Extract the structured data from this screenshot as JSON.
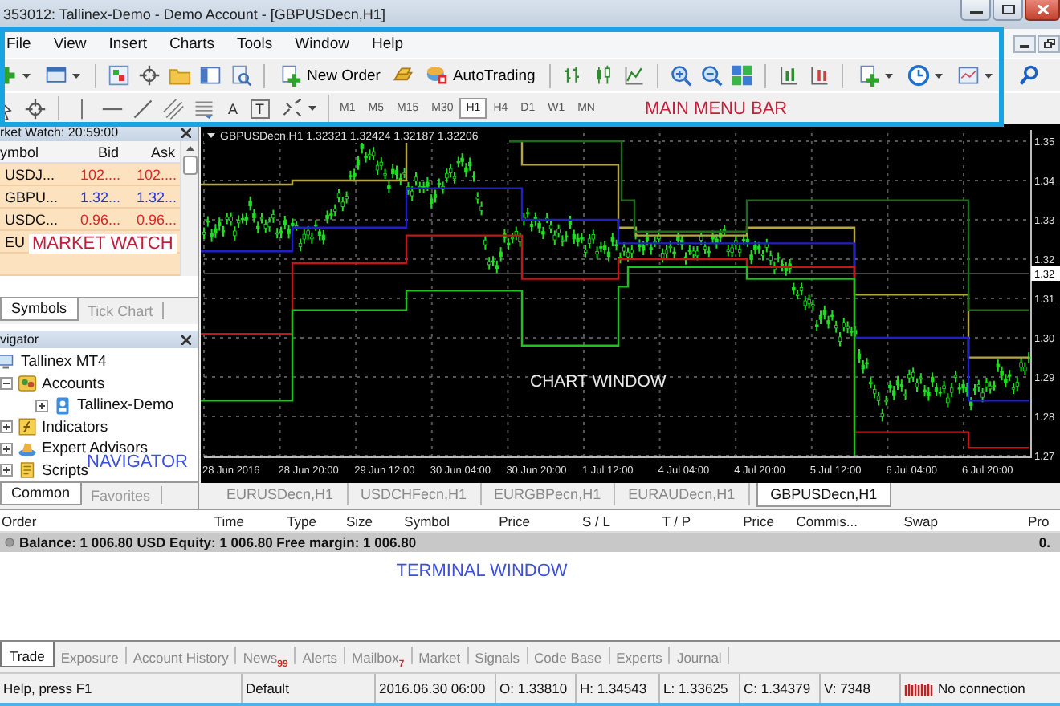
{
  "window": {
    "title": "353012: Tallinex-Demo - Demo Account - [GBPUSDecn,H1]"
  },
  "menu": [
    "File",
    "View",
    "Insert",
    "Charts",
    "Tools",
    "Window",
    "Help"
  ],
  "toolbar": {
    "new_order": "New Order",
    "autotrading": "AutoTrading",
    "text_tools": [
      "A",
      "T"
    ],
    "timeframes": [
      {
        "label": "M1",
        "selected": false
      },
      {
        "label": "M5",
        "selected": false
      },
      {
        "label": "M15",
        "selected": false
      },
      {
        "label": "M30",
        "selected": false
      },
      {
        "label": "H1",
        "selected": true
      },
      {
        "label": "H4",
        "selected": false
      },
      {
        "label": "D1",
        "selected": false
      },
      {
        "label": "W1",
        "selected": false
      },
      {
        "label": "MN",
        "selected": false
      }
    ],
    "callout": "MAIN MENU BAR"
  },
  "market_watch": {
    "title": "rket Watch: 20:59:00",
    "columns": [
      "ymbol",
      "Bid",
      "Ask"
    ],
    "rows": [
      {
        "symbol": "USDJ...",
        "bid": "102....",
        "ask": "102....",
        "color": "#e0242a"
      },
      {
        "symbol": "GBPU...",
        "bid": "1.32...",
        "ask": "1.32...",
        "color": "#2635d6"
      },
      {
        "symbol": "USDC...",
        "bid": "0.96...",
        "ask": "0.96...",
        "color": "#e0242a"
      },
      {
        "symbol": "EU"
      }
    ],
    "callout": "MARKET WATCH",
    "tabs": [
      {
        "label": "Symbols",
        "selected": true
      },
      {
        "label": "Tick Chart",
        "selected": false
      }
    ]
  },
  "navigator": {
    "title": "vigator",
    "tree": [
      {
        "label": "Tallinex MT4",
        "kind": "terminal",
        "children": [
          {
            "label": "Accounts",
            "kind": "accounts",
            "expanded": true,
            "children": [
              {
                "label": "Tallinex-Demo",
                "kind": "account",
                "expanded": false
              }
            ]
          },
          {
            "label": "Indicators",
            "kind": "indicators",
            "expanded": false
          },
          {
            "label": "Expert Advisors",
            "kind": "experts",
            "expanded": false
          },
          {
            "label": "Scripts",
            "kind": "scripts",
            "expanded": false
          }
        ]
      }
    ],
    "callout": "NAVIGATOR",
    "tabs": [
      {
        "label": "Common",
        "selected": true
      },
      {
        "label": "Favorites",
        "selected": false
      }
    ]
  },
  "chart": {
    "header": "GBPUSDecn,H1  1.32321 1.32424 1.32187 1.32206",
    "y_labels": [
      "1.35",
      "1.34",
      "1.33",
      "1.32",
      "1.31",
      "1.30",
      "1.29",
      "1.28",
      "1.27"
    ],
    "x_labels": [
      "28 Jun 2016",
      "28 Jun 20:00",
      "29 Jun 12:00",
      "30 Jun 04:00",
      "30 Jun 20:00",
      "1 Jul 12:00",
      "4 Jul 04:00",
      "4 Jul 20:00",
      "5 Jul 12:00",
      "6 Jul 04:00",
      "6 Jul 20:00"
    ],
    "price_marker": "1.32",
    "callout": "CHART WINDOW",
    "tabs": [
      {
        "label": "EURUSDecn,H1",
        "selected": false
      },
      {
        "label": "USDCHFecn,H1",
        "selected": false
      },
      {
        "label": "EURGBPecn,H1",
        "selected": false
      },
      {
        "label": "EURAUDecn,H1",
        "selected": false
      },
      {
        "label": "GBPUSDecn,H1",
        "selected": true
      }
    ]
  },
  "terminal": {
    "columns": [
      "Order",
      "Time",
      "Type",
      "Size",
      "Symbol",
      "Price",
      "S / L",
      "T / P",
      "Price",
      "Commis...",
      "Swap",
      "Pro"
    ],
    "balance": "Balance: 1 006.80 USD  Equity: 1 006.80  Free margin: 1 006.80",
    "balance_profit": "0.",
    "callout": "TERMINAL WINDOW",
    "tabs": [
      {
        "label": "Trade",
        "selected": true
      },
      {
        "label": "Exposure",
        "selected": false
      },
      {
        "label": "Account History",
        "selected": false
      },
      {
        "label": "News",
        "badge": "99",
        "selected": false
      },
      {
        "label": "Alerts",
        "selected": false
      },
      {
        "label": "Mailbox",
        "badge": "7",
        "selected": false
      },
      {
        "label": "Market",
        "selected": false
      },
      {
        "label": "Signals",
        "selected": false
      },
      {
        "label": "Code Base",
        "selected": false
      },
      {
        "label": "Experts",
        "selected": false
      },
      {
        "label": "Journal",
        "selected": false
      }
    ]
  },
  "status_bar": {
    "cells": [
      "Help, press F1",
      "Default",
      "2016.06.30 06:00",
      "O: 1.33810",
      "H: 1.34543",
      "L: 1.33625",
      "C: 1.34379",
      "V: 7348"
    ],
    "connection": "No connection"
  }
}
